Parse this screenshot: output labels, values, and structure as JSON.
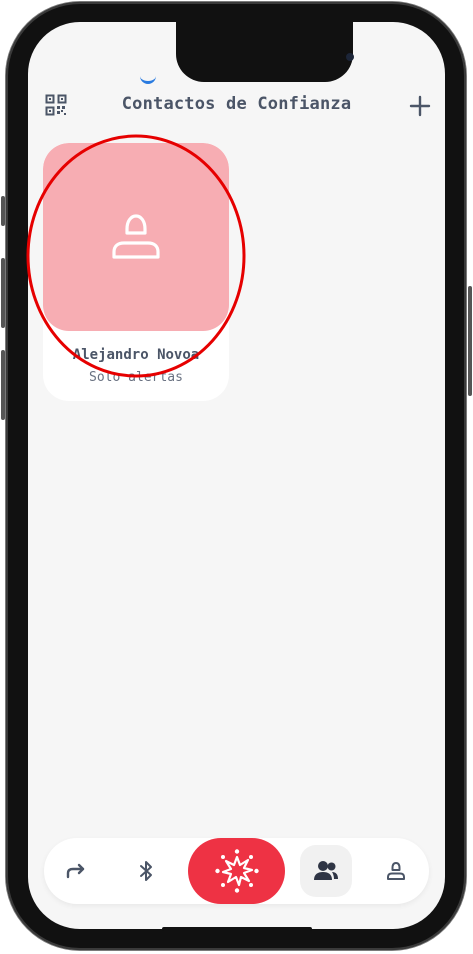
{
  "header": {
    "title": "Contactos de Confianza"
  },
  "contacts": [
    {
      "name": "Alejandro Novoa",
      "status": "Solo alertas"
    }
  ],
  "nav": {
    "items": [
      {
        "icon": "share-arrow-icon"
      },
      {
        "icon": "bluetooth-icon"
      },
      {
        "icon": "sos-burst-icon"
      },
      {
        "icon": "users-icon",
        "active": true
      },
      {
        "icon": "profile-icon"
      }
    ]
  },
  "colors": {
    "accent": "#ee3244",
    "avatar_bg": "#f7adb3",
    "text": "#4b5567",
    "annotation": "#e60000"
  }
}
